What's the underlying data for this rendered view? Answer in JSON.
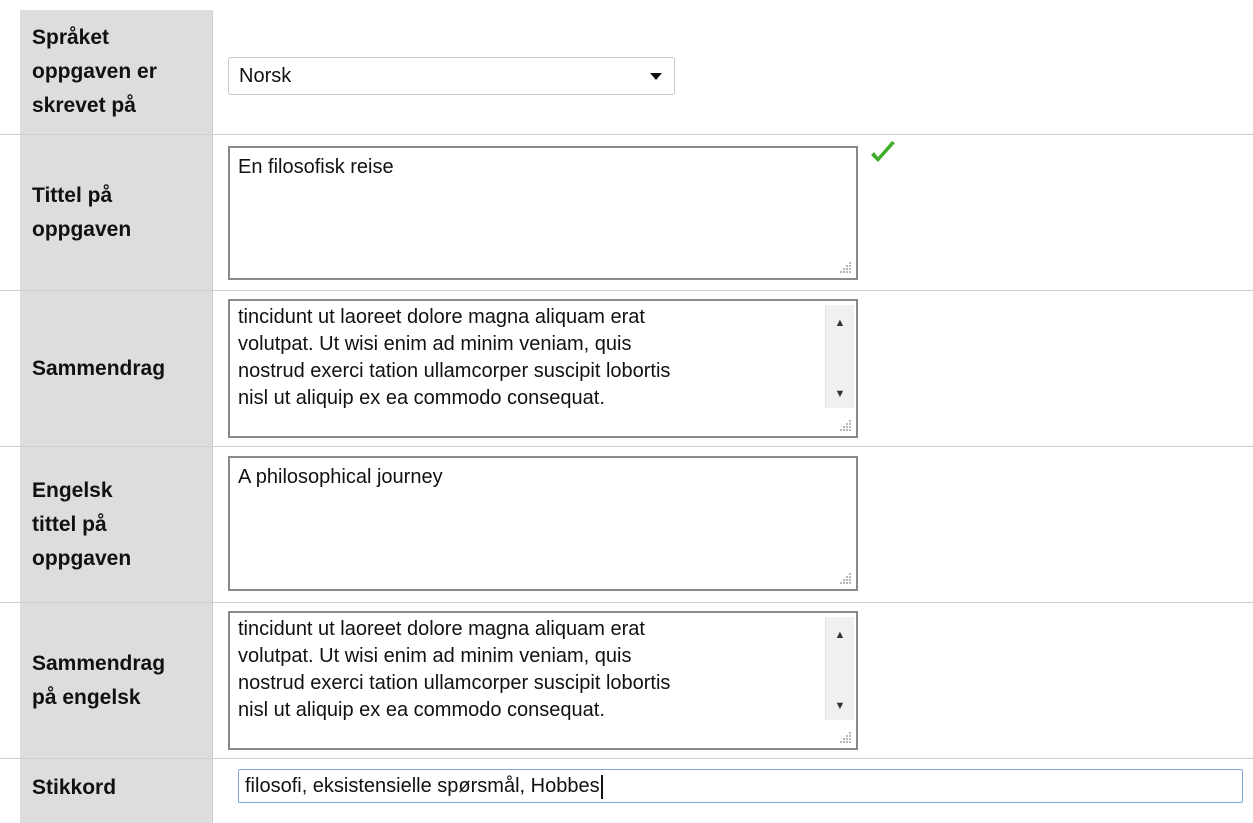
{
  "form": {
    "language": {
      "label_lines": [
        "Språket",
        "oppgaven er",
        "skrevet på"
      ],
      "selected": "Norsk"
    },
    "title": {
      "label_lines": [
        "Tittel på",
        "oppgaven"
      ],
      "value": "En filosofisk reise"
    },
    "summary": {
      "label_lines": [
        "Sammendrag"
      ],
      "lines": [
        "tincidunt ut laoreet dolore magna aliquam erat",
        "volutpat. Ut wisi enim ad minim veniam, quis",
        "nostrud exerci tation ullamcorper suscipit lobortis",
        "nisl ut aliquip ex ea commodo consequat."
      ]
    },
    "english_title": {
      "label_lines": [
        "Engelsk",
        "tittel på",
        "oppgaven"
      ],
      "value": "A philosophical journey"
    },
    "english_summary": {
      "label_lines": [
        "Sammendrag",
        "på engelsk"
      ],
      "lines": [
        "tincidunt ut laoreet dolore magna aliquam erat",
        "volutpat. Ut wisi enim ad minim veniam, quis",
        "nostrud exerci tation ullamcorper suscipit lobortis",
        "nisl ut aliquip ex ea commodo consequat."
      ]
    },
    "keywords": {
      "label_lines": [
        "Stikkord"
      ],
      "value": "filosofi, eksistensielle spørsmål, Hobbes"
    }
  },
  "icons": {
    "check": "check-icon",
    "dropdown": "chevron-down-icon",
    "scroll_up": "scroll-up-arrow-icon",
    "scroll_down": "scroll-down-arrow-icon"
  },
  "colors": {
    "label_bg": "#dddddd",
    "check_green": "#3fae2a",
    "focus_border": "#7fa8d8"
  }
}
